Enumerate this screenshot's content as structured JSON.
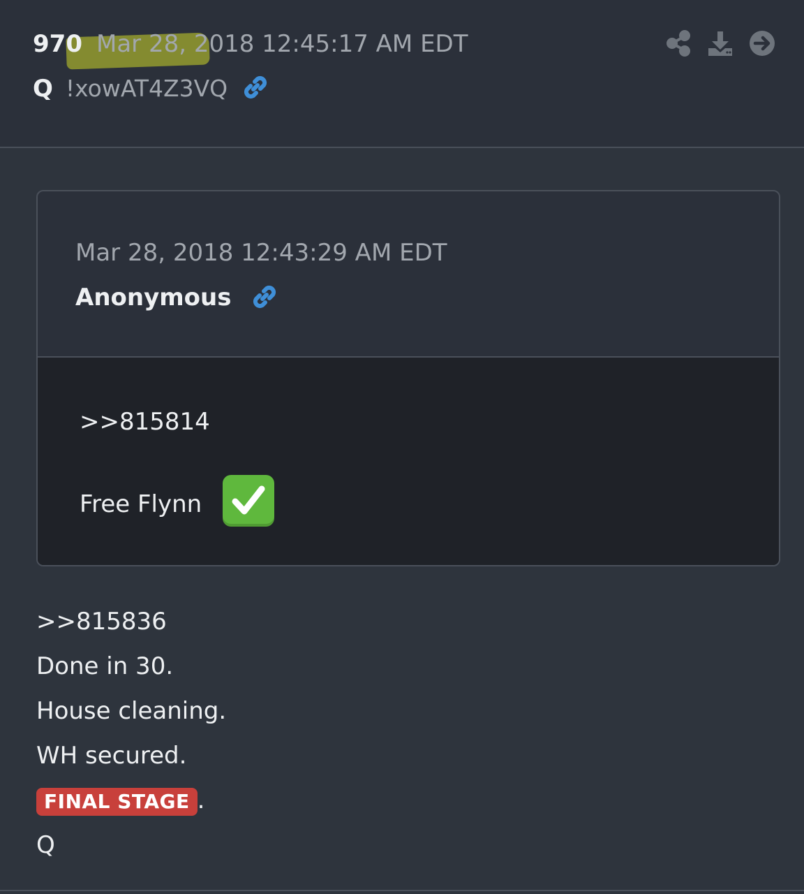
{
  "post": {
    "number": "970",
    "date": "Mar 28, 2018 12:45:17 AM EDT",
    "author": "Q",
    "tripcode": "!xowAT4Z3VQ"
  },
  "actions": [
    "share-icon",
    "download-icon",
    "arrow-right-circle-icon"
  ],
  "quoted": {
    "date": "Mar 28, 2018 12:43:29 AM EDT",
    "author": "Anonymous",
    "reply_ref": ">>815814",
    "text": "Free Flynn",
    "emoji": "check-mark-button"
  },
  "body": {
    "reply_ref": ">>815836",
    "lines": [
      "Done in 30.",
      "House cleaning.",
      "WH secured."
    ],
    "badge": "FINAL STAGE",
    "badge_suffix": ".",
    "signature": "Q"
  },
  "colors": {
    "background": "#2e343d",
    "header": "#2b303a",
    "quote_body": "#1f2228",
    "link_blue": "#3f8fd8",
    "badge_red": "#c8403b",
    "highlighter": "#cdd728",
    "check_green": "#5fb83d"
  }
}
